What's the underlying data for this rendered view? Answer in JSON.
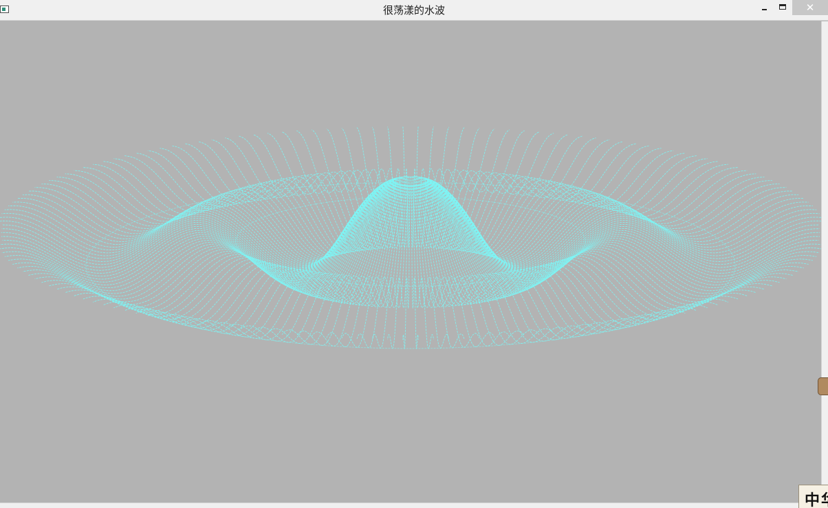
{
  "window": {
    "title": "很荡漾的水波",
    "close_glyph": "✕",
    "background_color": "#b3b3b3",
    "wave_color": "#7ef4f4"
  },
  "overlay": {
    "corner_logo_text": "中华"
  },
  "icons": {
    "app": "app-window-icon",
    "minimize": "minimize-icon",
    "maximize": "maximize-icon",
    "close": "close-icon"
  }
}
